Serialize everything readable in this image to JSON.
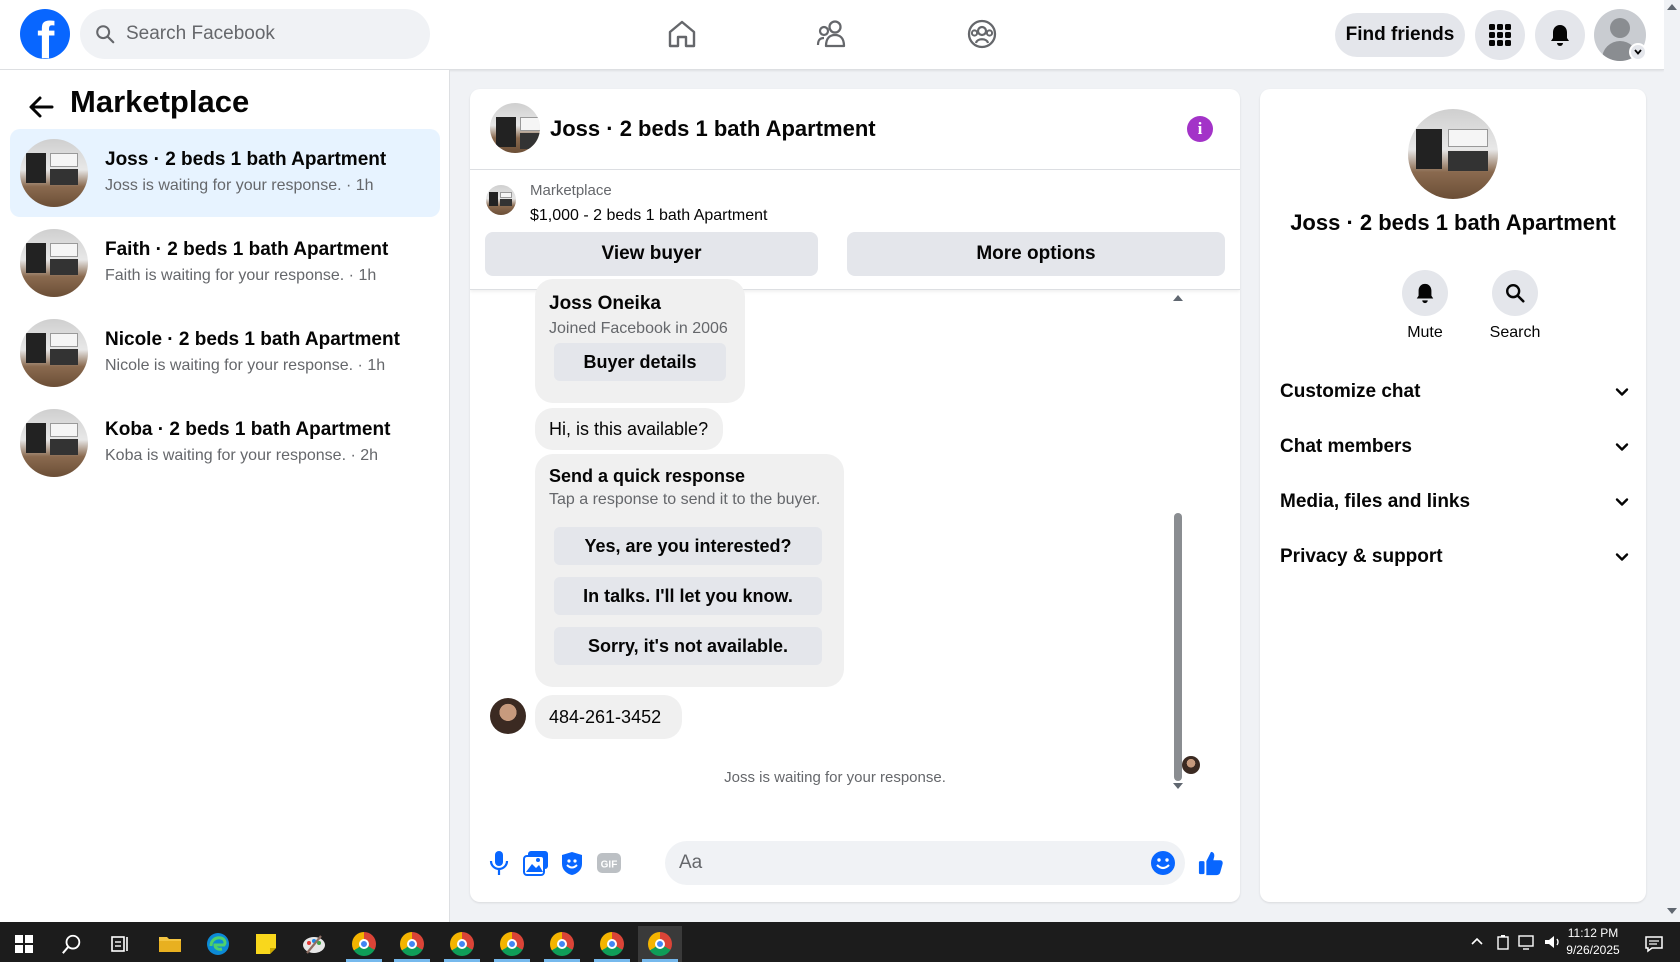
{
  "topbar": {
    "search_placeholder": "Search Facebook",
    "find_friends": "Find friends",
    "logo_letter": "f"
  },
  "sidebar": {
    "title": "Marketplace",
    "conversations": [
      {
        "name": "Joss · 2 beds 1 bath Apartment",
        "sub": "Joss is waiting for your response. · 1h",
        "active": true
      },
      {
        "name": "Faith · 2 beds 1 bath Apartment",
        "sub": "Faith is waiting for your response. · 1h",
        "active": false
      },
      {
        "name": "Nicole · 2 beds 1 bath Apartment",
        "sub": "Nicole is waiting for your response. · 1h",
        "active": false
      },
      {
        "name": "Koba · 2 beds 1 bath Apartment",
        "sub": "Koba is waiting for your response. · 2h",
        "active": false
      }
    ]
  },
  "chat": {
    "title": "Joss · 2 beds 1 bath Apartment",
    "marketplace_label": "Marketplace",
    "listing": "$1,000 - 2 beds 1 bath Apartment",
    "view_buyer": "View buyer",
    "more_options": "More options",
    "buyer_card": {
      "name": "Joss Oneika",
      "joined": "Joined Facebook in 2006",
      "details_button": "Buyer details"
    },
    "message_1": "Hi, is this available?",
    "quick": {
      "title": "Send a quick response",
      "subtitle": "Tap a response to send it to the buyer.",
      "options": [
        "Yes, are you interested?",
        "In talks. I'll let you know.",
        "Sorry, it's not available."
      ]
    },
    "message_2": "484-261-3452",
    "waiting": "Joss is waiting for your response.",
    "composer_placeholder": "Aa"
  },
  "right_panel": {
    "title": "Joss · 2 beds 1 bath Apartment",
    "mute": "Mute",
    "search": "Search",
    "sections": [
      "Customize chat",
      "Chat members",
      "Media, files and links",
      "Privacy & support"
    ]
  },
  "taskbar": {
    "time": "11:12 PM",
    "date": "9/26/2025"
  },
  "colors": {
    "brand_blue": "#0866ff",
    "active_conv_bg": "#e7f3ff",
    "info_purple": "#a333c8",
    "composer_icon_blue": "#0866ff"
  }
}
